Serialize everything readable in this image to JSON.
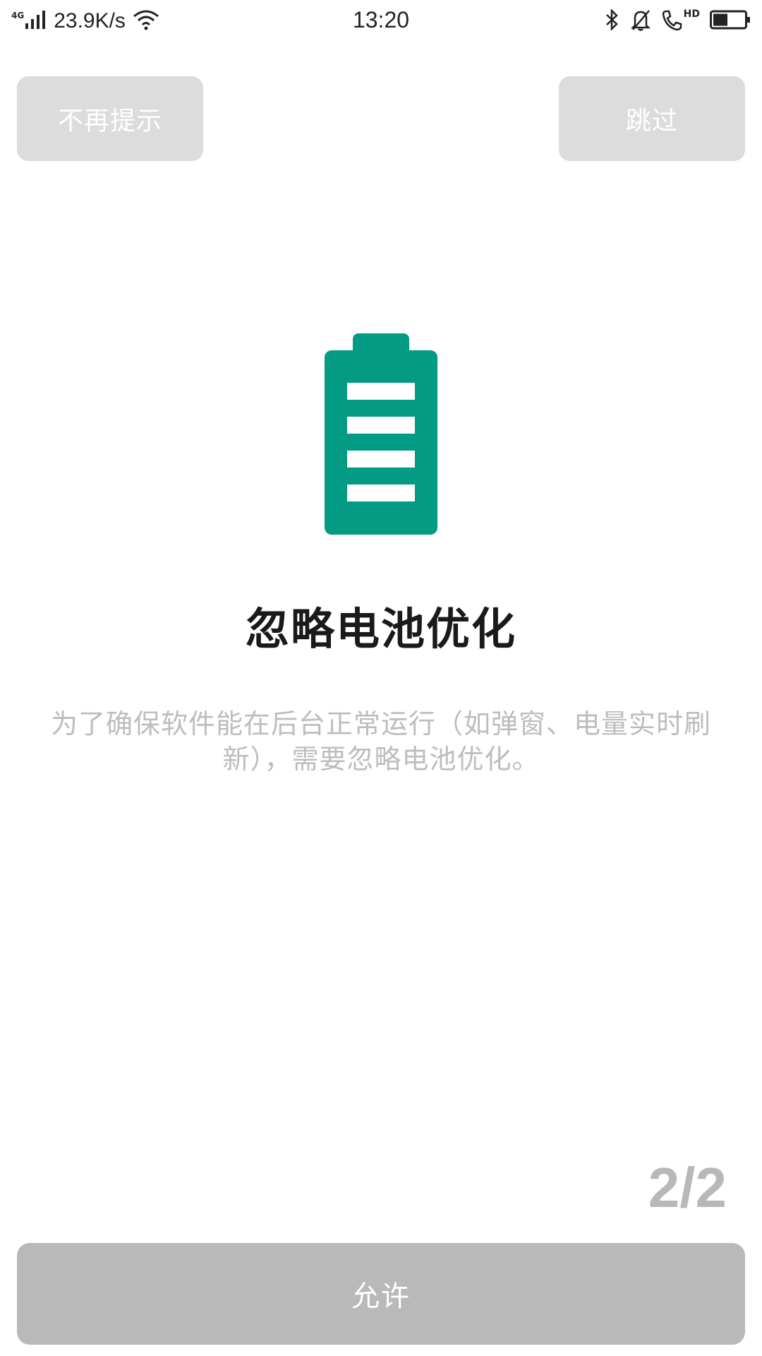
{
  "status_bar": {
    "network_type": "4G",
    "speed": "23.9K/s",
    "time": "13:20",
    "hd_label": "HD",
    "icons": [
      "signal-icon",
      "wifi-icon",
      "bluetooth-icon",
      "bell-muted-icon",
      "call-icon",
      "battery-icon"
    ]
  },
  "top_bar": {
    "dont_remind_label": "不再提示",
    "skip_label": "跳过"
  },
  "illustration": {
    "icon": "battery-full-icon",
    "color": "#039b83"
  },
  "content": {
    "title": "忽略电池优化",
    "description": "为了确保软件能在后台正常运行（如弹窗、电量实时刷新），需要忽略电池优化。"
  },
  "pager": {
    "indicator": "2/2"
  },
  "footer": {
    "allow_label": "允许"
  },
  "colors": {
    "accent": "#039b83",
    "button_light": "#dcdcdc",
    "button_primary_disabled": "#b9b9b9",
    "description_text": "#bdbdbd"
  }
}
